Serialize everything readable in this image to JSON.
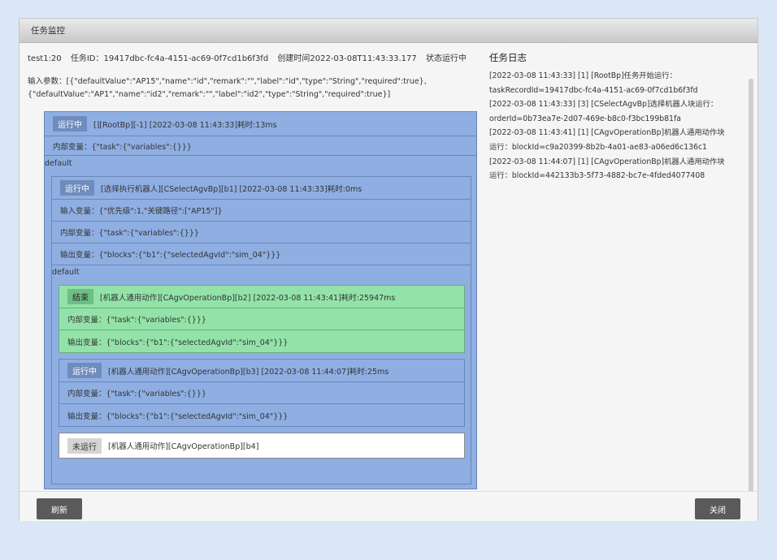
{
  "dialog": {
    "title": "任务监控"
  },
  "info": {
    "name": "test1:20",
    "task_id": "任务ID：19417dbc-fc4a-4151-ac69-0f7cd1b6f3fd",
    "created": "创建时间2022-03-08T11:43:33.177",
    "status": "状态运行中"
  },
  "params": {
    "line1": "输入参数：[{\"defaultValue\":\"AP15\",\"name\":\"id\",\"remark\":\"\",\"label\":\"id\",\"type\":\"String\",\"required\":true},",
    "line2": "{\"defaultValue\":\"AP1\",\"name\":\"id2\",\"remark\":\"\",\"label\":\"id2\",\"type\":\"String\",\"required\":true}]"
  },
  "root": {
    "status": "运行中",
    "title": "[][RootBp][-1] [2022-03-08 11:43:33]耗时:13ms",
    "internal": "内部变量：{\"task\":{\"variables\":{}}}",
    "default_label": "default"
  },
  "b1": {
    "status": "运行中",
    "title": "[选择执行机器人][CSelectAgvBp][b1] [2022-03-08 11:43:33]耗时:0ms",
    "input": "输入变量：{\"优先级\":1,\"关键路径\":[\"AP15\"]}",
    "internal": "内部变量：{\"task\":{\"variables\":{}}}",
    "output": "输出变量：{\"blocks\":{\"b1\":{\"selectedAgvId\":\"sim_04\"}}}",
    "default_label": "default"
  },
  "b2": {
    "status": "结束",
    "title": "[机器人通用动作][CAgvOperationBp][b2] [2022-03-08 11:43:41]耗时:25947ms",
    "internal": "内部变量：{\"task\":{\"variables\":{}}}",
    "output": "输出变量：{\"blocks\":{\"b1\":{\"selectedAgvId\":\"sim_04\"}}}"
  },
  "b3": {
    "status": "运行中",
    "title": "[机器人通用动作][CAgvOperationBp][b3] [2022-03-08 11:44:07]耗时:25ms",
    "internal": "内部变量：{\"task\":{\"variables\":{}}}",
    "output": "输出变量：{\"blocks\":{\"b1\":{\"selectedAgvId\":\"sim_04\"}}}"
  },
  "b4": {
    "status": "未运行",
    "title": "[机器人通用动作][CAgvOperationBp][b4]"
  },
  "log": {
    "title": "任务日志",
    "lines": [
      "[2022-03-08 11:43:33] [1] [RootBp]任务开始运行：",
      "taskRecordId=19417dbc-fc4a-4151-ac69-0f7cd1b6f3fd",
      "[2022-03-08 11:43:33] [3] [CSelectAgvBp]选择机器人块运行：",
      "orderId=0b73ea7e-2d07-469e-b8c0-f3bc199b81fa",
      "[2022-03-08 11:43:41] [1] [CAgvOperationBp]机器人通用动作块",
      "运行：blockId=c9a20399-8b2b-4a01-ae83-a06ed6c136c1",
      "[2022-03-08 11:44:07] [1] [CAgvOperationBp]机器人通用动作块",
      "运行：blockId=442133b3-5f73-4882-bc7e-4fded4077408"
    ]
  },
  "footer": {
    "refresh_label": "刷新",
    "close_label": "关闭"
  },
  "colors": {
    "running_box": "#8faee2",
    "done_box": "#93e3a9",
    "notrun_box": "#ffffff"
  }
}
